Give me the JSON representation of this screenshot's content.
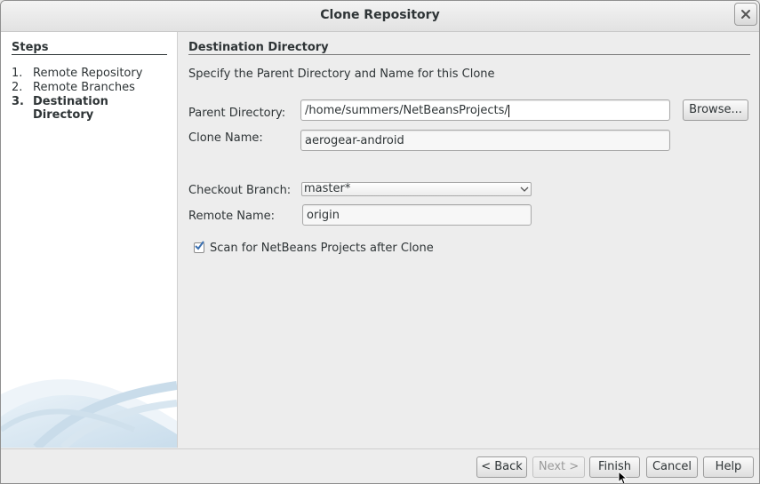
{
  "window": {
    "title": "Clone Repository"
  },
  "sidebar": {
    "title": "Steps",
    "steps": [
      {
        "num": "1.",
        "label": "Remote Repository"
      },
      {
        "num": "2.",
        "label": "Remote Branches"
      },
      {
        "num": "3.",
        "label": "Destination Directory"
      }
    ]
  },
  "content": {
    "section_title": "Destination Directory",
    "description": "Specify the Parent Directory and Name for this Clone",
    "parent_dir_label": "Parent Directory:",
    "parent_dir_value": "/home/summers/NetBeansProjects/",
    "browse_label": "Browse...",
    "clone_name_label": "Clone Name:",
    "clone_name_value": "aerogear-android",
    "checkout_branch_label": "Checkout Branch:",
    "checkout_branch_value": "master*",
    "remote_name_label": "Remote Name:",
    "remote_name_value": "origin",
    "scan_label": "Scan for NetBeans Projects after Clone",
    "scan_checked": true
  },
  "footer": {
    "back": "< Back",
    "next": "Next >",
    "finish": "Finish",
    "cancel": "Cancel",
    "help": "Help"
  },
  "colors": {
    "accent": "#4a90d9",
    "sidebar_bg": "#ffffff",
    "dialog_bg": "#ededed"
  }
}
